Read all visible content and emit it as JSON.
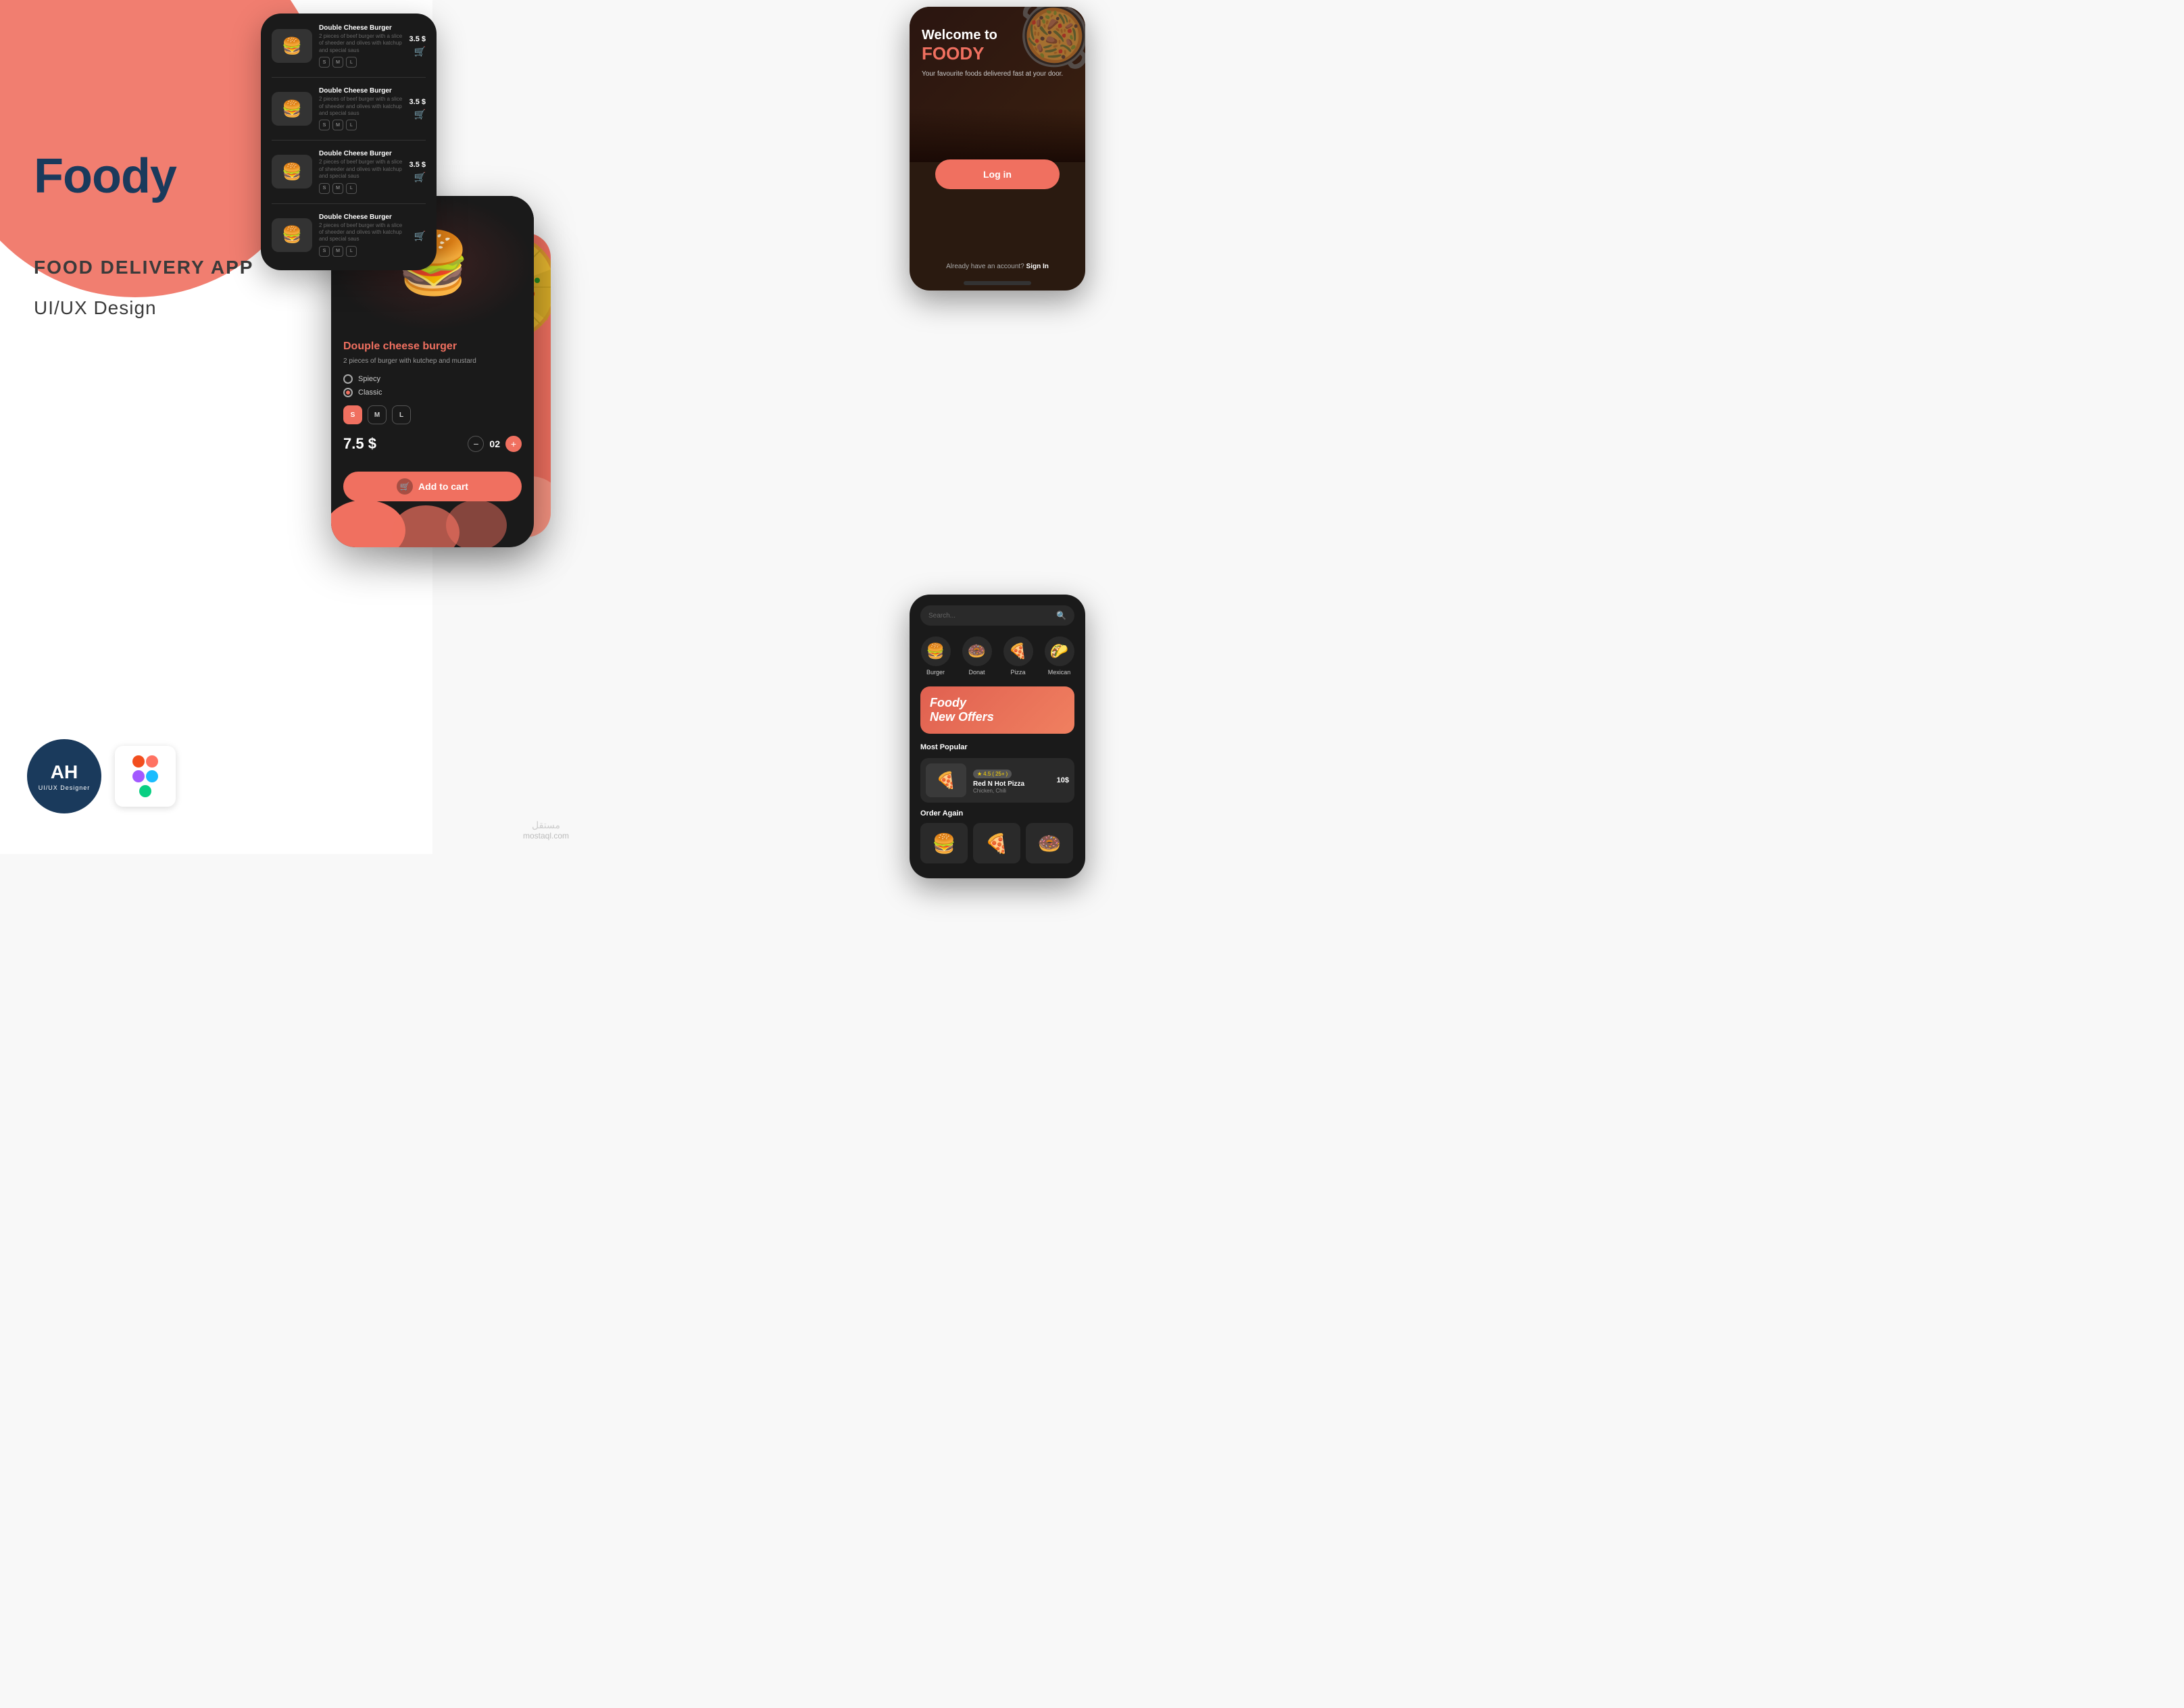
{
  "brand": {
    "name": "Foody",
    "tagline": "FOOD DELIVERY APP",
    "design_type": "UI/UX Design"
  },
  "welcome_screen": {
    "title_line1": "Welcome to",
    "title_line2": "FOODY",
    "subtitle": "Your favourite foods delivered fast at your door.",
    "login_label": "Log in",
    "signup_text": "Already have an account?",
    "signup_link": "Sign In"
  },
  "product_detail": {
    "name": "Douple cheese burger",
    "description": "2 pieces of burger with kutchep and mustard",
    "options": [
      {
        "label": "Spiecy",
        "selected": false
      },
      {
        "label": "Classic",
        "selected": true
      }
    ],
    "sizes": [
      "S",
      "M",
      "L"
    ],
    "active_size": "S",
    "price": "7.5 $",
    "quantity": "02",
    "add_to_cart": "Add to cart"
  },
  "list_items": [
    {
      "name": "Double Cheese Burger",
      "desc": "2 pieces of beef burger with a slice of sheeder and olives with katchup and special saus",
      "price": "3.5 $",
      "sizes": [
        "S",
        "M",
        "L"
      ]
    },
    {
      "name": "Double Cheese Burger",
      "desc": "2 pieces of beef burger with a slice of sheeder and olives with katchup and special saus",
      "price": "3.5 $",
      "sizes": [
        "S",
        "M",
        "L"
      ]
    },
    {
      "name": "Double Cheese Burger",
      "desc": "2 pieces of beef burger with a slice of sheeder and olives with katchup and special saus",
      "price": "3.5 $",
      "sizes": [
        "S",
        "M",
        "L"
      ]
    },
    {
      "name": "Double Cheese Burger",
      "desc": "2 pieces of beef burger with a slice of sheeder and olives with katchup and special saus",
      "price": "",
      "sizes": [
        "S",
        "M",
        "L"
      ]
    }
  ],
  "browse_screen": {
    "search_placeholder": "Search...",
    "categories": [
      {
        "label": "Burger",
        "icon": "🍔"
      },
      {
        "label": "Donat",
        "icon": "🍩"
      },
      {
        "label": "Pizza",
        "icon": "🍕"
      },
      {
        "label": "Mexican",
        "icon": "🌮"
      }
    ],
    "promo": {
      "line1": "Foody",
      "line2": "New Offers"
    },
    "most_popular_label": "Most Popular",
    "popular_item": {
      "name": "Red N Hot Pizza",
      "sub": "Chicken, Chili",
      "price": "10$",
      "rating": "4.5",
      "reviews": "25+"
    },
    "order_again_label": "Order Again"
  },
  "watermark": {
    "arabic": "مستقل",
    "latin": "mostaql.com"
  },
  "colors": {
    "primary": "#F07060",
    "dark_bg": "#1a1a1a",
    "dark_card": "#2a2a2a",
    "text_light": "#ffffff",
    "text_muted": "#999999",
    "navy": "#1a3a5c"
  }
}
